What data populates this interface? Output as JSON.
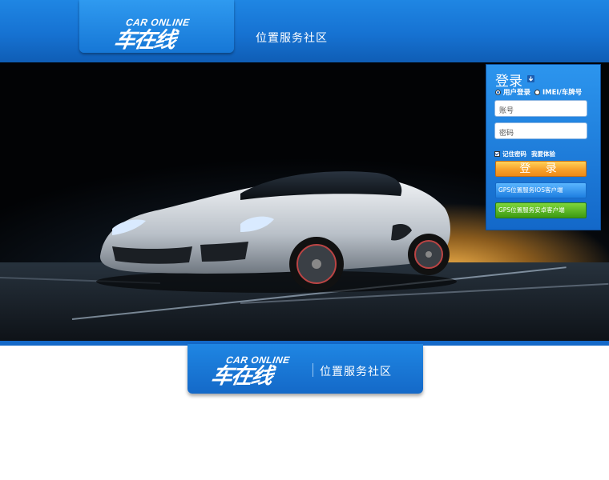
{
  "brand": {
    "logo_en": "CAR ONLINE",
    "logo_cn": "车在线",
    "tagline": "位置服务社区"
  },
  "login": {
    "title": "登录",
    "radio_user": "用户登录",
    "radio_imei": "IMEI/车牌号",
    "account_placeholder": "账号",
    "password_placeholder": "密码",
    "remember_label": "记住密码",
    "trial_label": "我要体验",
    "submit_label": "登 录"
  },
  "clients": {
    "ios_label": "GPS位置服务IOS客户端",
    "android_label": "GPS位置服务安卓客户端"
  },
  "colors": {
    "brand_blue": "#1672d2",
    "login_orange": "#f7a12b",
    "android_green": "#3c9a12",
    "ios_blue": "#1e7ee0"
  },
  "icons": {
    "title_arrow": "download-arrow-icon",
    "hero": "sports-car-image"
  }
}
